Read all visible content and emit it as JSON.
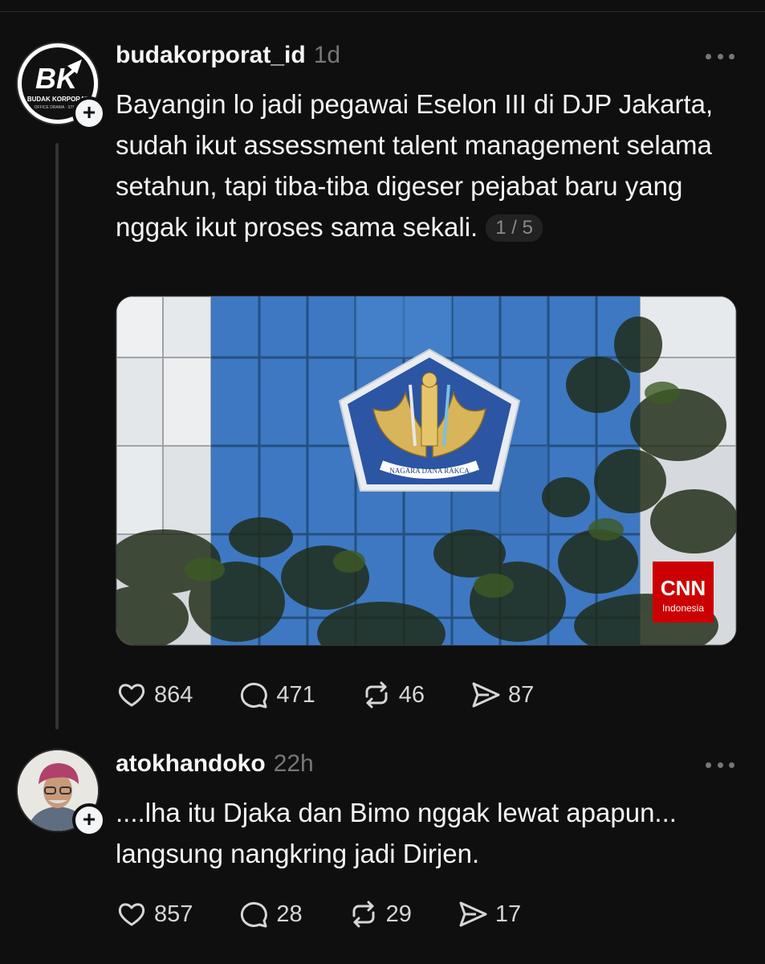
{
  "post": {
    "username": "budakorporat_id",
    "time": "1d",
    "avatar_logo": "BK",
    "avatar_caption": "BUDAK KORPORAT",
    "avatar_subcaption": "OFFICE DRAMA · STORY",
    "text": "Bayangin lo jadi pegawai Eselon III di DJP Jakarta, sudah ikut assessment talent management selama setahun, tapi tiba-tiba digeser pejabat baru yang nggak ikut proses sama sekali.",
    "pager": "1 / 5",
    "image": {
      "emblem_text": "NAGARA DANA RAKCA",
      "watermark": "CNN",
      "watermark_sub": "Indonesia"
    },
    "likes": "864",
    "replies": "471",
    "reposts": "46",
    "shares": "87"
  },
  "reply": {
    "username": "atokhandoko",
    "time": "22h",
    "text": "....lha itu Djaka dan Bimo nggak lewat apapun... langsung nangkring jadi Dirjen.",
    "likes": "857",
    "replies": "28",
    "reposts": "29",
    "shares": "17"
  },
  "icons": {
    "like": "heart-icon",
    "reply": "comment-bubble-icon",
    "repost": "repost-icon",
    "share": "send-icon",
    "more": "more-dots-icon",
    "follow": "plus-icon"
  },
  "colors": {
    "background": "#0f0f0f",
    "text": "#f3f5f7",
    "muted": "#777777",
    "cnn_red": "#cc0000"
  }
}
